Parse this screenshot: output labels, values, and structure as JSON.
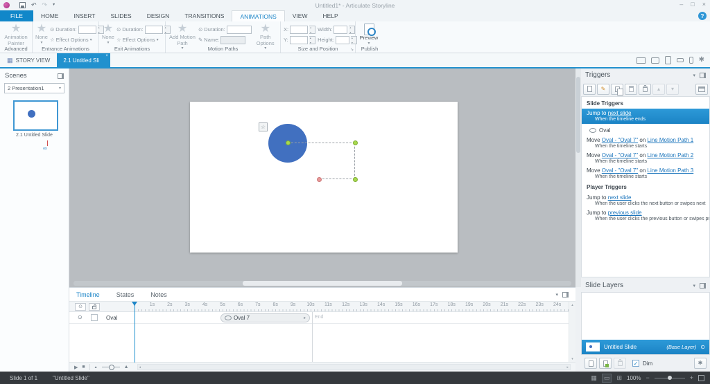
{
  "colors": {
    "accent": "#2191ce",
    "file_tab_blue": "#1187c9",
    "selection_blue": "#1f8ccd",
    "link_blue": "#1b75bc",
    "oval_fill": "#4170c0",
    "canvas_gray": "#b9bdc1",
    "statusbar_dark": "#35393d",
    "path_dot_green": "#a8d94e",
    "path_dot_red": "#e89a9a"
  },
  "icons": {
    "undo": "↶",
    "redo": "↷",
    "more": "▾",
    "minimize": "–",
    "maximize": "□",
    "close": "×",
    "help": "?",
    "caret_down": "▾",
    "clock": "⊙",
    "star": "★",
    "star_outline": "☆",
    "pencil": "✎",
    "gear": "✱",
    "story_view": "▦",
    "eye": "⊙",
    "play": "▶",
    "stop": "■",
    "up": "▴",
    "down": "▾",
    "left": "◂",
    "right": "▸",
    "check": "✓",
    "link": "∞",
    "minus": "−",
    "plus": "+",
    "launcher": "↘",
    "zoom_tri": "▲",
    "grid": "▦",
    "film": "▭",
    "feed": "⊞"
  },
  "titlebar": {
    "title": "Untitled1* - Articulate Storyline"
  },
  "ribbon_tabs": [
    {
      "label": "FILE"
    },
    {
      "label": "HOME"
    },
    {
      "label": "INSERT"
    },
    {
      "label": "SLIDES"
    },
    {
      "label": "DESIGN"
    },
    {
      "label": "TRANSITIONS"
    },
    {
      "label": "ANIMATIONS"
    },
    {
      "label": "VIEW"
    },
    {
      "label": "HELP"
    }
  ],
  "ribbon": {
    "advanced": {
      "button": "Animation Painter",
      "label": "Advanced"
    },
    "entrance": {
      "none": "None",
      "effect_options": "Effect Options",
      "duration": "Duration:",
      "label": "Entrance Animations"
    },
    "exit": {
      "none": "None",
      "effect_options": "Effect Options",
      "duration": "Duration:",
      "label": "Exit Animations"
    },
    "motion": {
      "add": "Add Motion Path",
      "duration": "Duration:",
      "name": "Name:",
      "path_options": "Path Options",
      "label": "Motion Paths"
    },
    "size": {
      "x": "X:",
      "y": "Y:",
      "width": "Width:",
      "height": "Height:",
      "label": "Size and Position"
    },
    "publish": {
      "preview": "Preview",
      "label": "Publish"
    }
  },
  "view_tabs": {
    "story_view": "STORY VIEW",
    "slide_tab": "2.1 Untitled Sli"
  },
  "scenes": {
    "title": "Scenes",
    "dropdown": "2 Presentation1",
    "slide_label": "2.1 Untitled Slide"
  },
  "triggers": {
    "title": "Triggers",
    "slide_heading": "Slide Triggers",
    "selected": {
      "prefix": "Jump to ",
      "link": "next slide",
      "condition": "When the timeline ends"
    },
    "group_label": "Oval",
    "moves": [
      {
        "prefix": "Move ",
        "object": "Oval - \"Oval 7\"",
        "mid": " on ",
        "path": "Line Motion Path 1",
        "condition": "When the timeline starts"
      },
      {
        "prefix": "Move ",
        "object": "Oval - \"Oval 7\"",
        "mid": " on ",
        "path": "Line Motion Path 2",
        "condition": "When the timeline starts"
      },
      {
        "prefix": "Move ",
        "object": "Oval - \"Oval 7\"",
        "mid": " on ",
        "path": "Line Motion Path 3",
        "condition": "When the timeline starts"
      }
    ],
    "player_heading": "Player Triggers",
    "player": [
      {
        "prefix": "Jump to ",
        "link": "next slide",
        "condition": "When the user clicks the next button or swipes next"
      },
      {
        "prefix": "Jump to ",
        "link": "previous slide",
        "condition": "When the user clicks the previous button or swipes prev..."
      }
    ]
  },
  "slide_layers": {
    "title": "Slide Layers",
    "layer_name": "Untitled Slide",
    "layer_tag": "(Base Layer)",
    "dim_label": "Dim"
  },
  "timeline": {
    "tabs": [
      "Timeline",
      "States",
      "Notes"
    ],
    "ticks": [
      "1s",
      "2s",
      "3s",
      "4s",
      "5s",
      "6s",
      "7s",
      "8s",
      "9s",
      "10s",
      "11s",
      "12s",
      "13s",
      "14s",
      "15s",
      "16s",
      "17s",
      "18s",
      "19s",
      "20s",
      "21s",
      "22s",
      "23s",
      "24s"
    ],
    "row_name": "Oval",
    "bar_label": "Oval 7",
    "end_label": "End"
  },
  "statusbar": {
    "slide_info": "Slide 1 of 1",
    "slide_title": "\"Untitled Slide\"",
    "zoom": "100%"
  }
}
